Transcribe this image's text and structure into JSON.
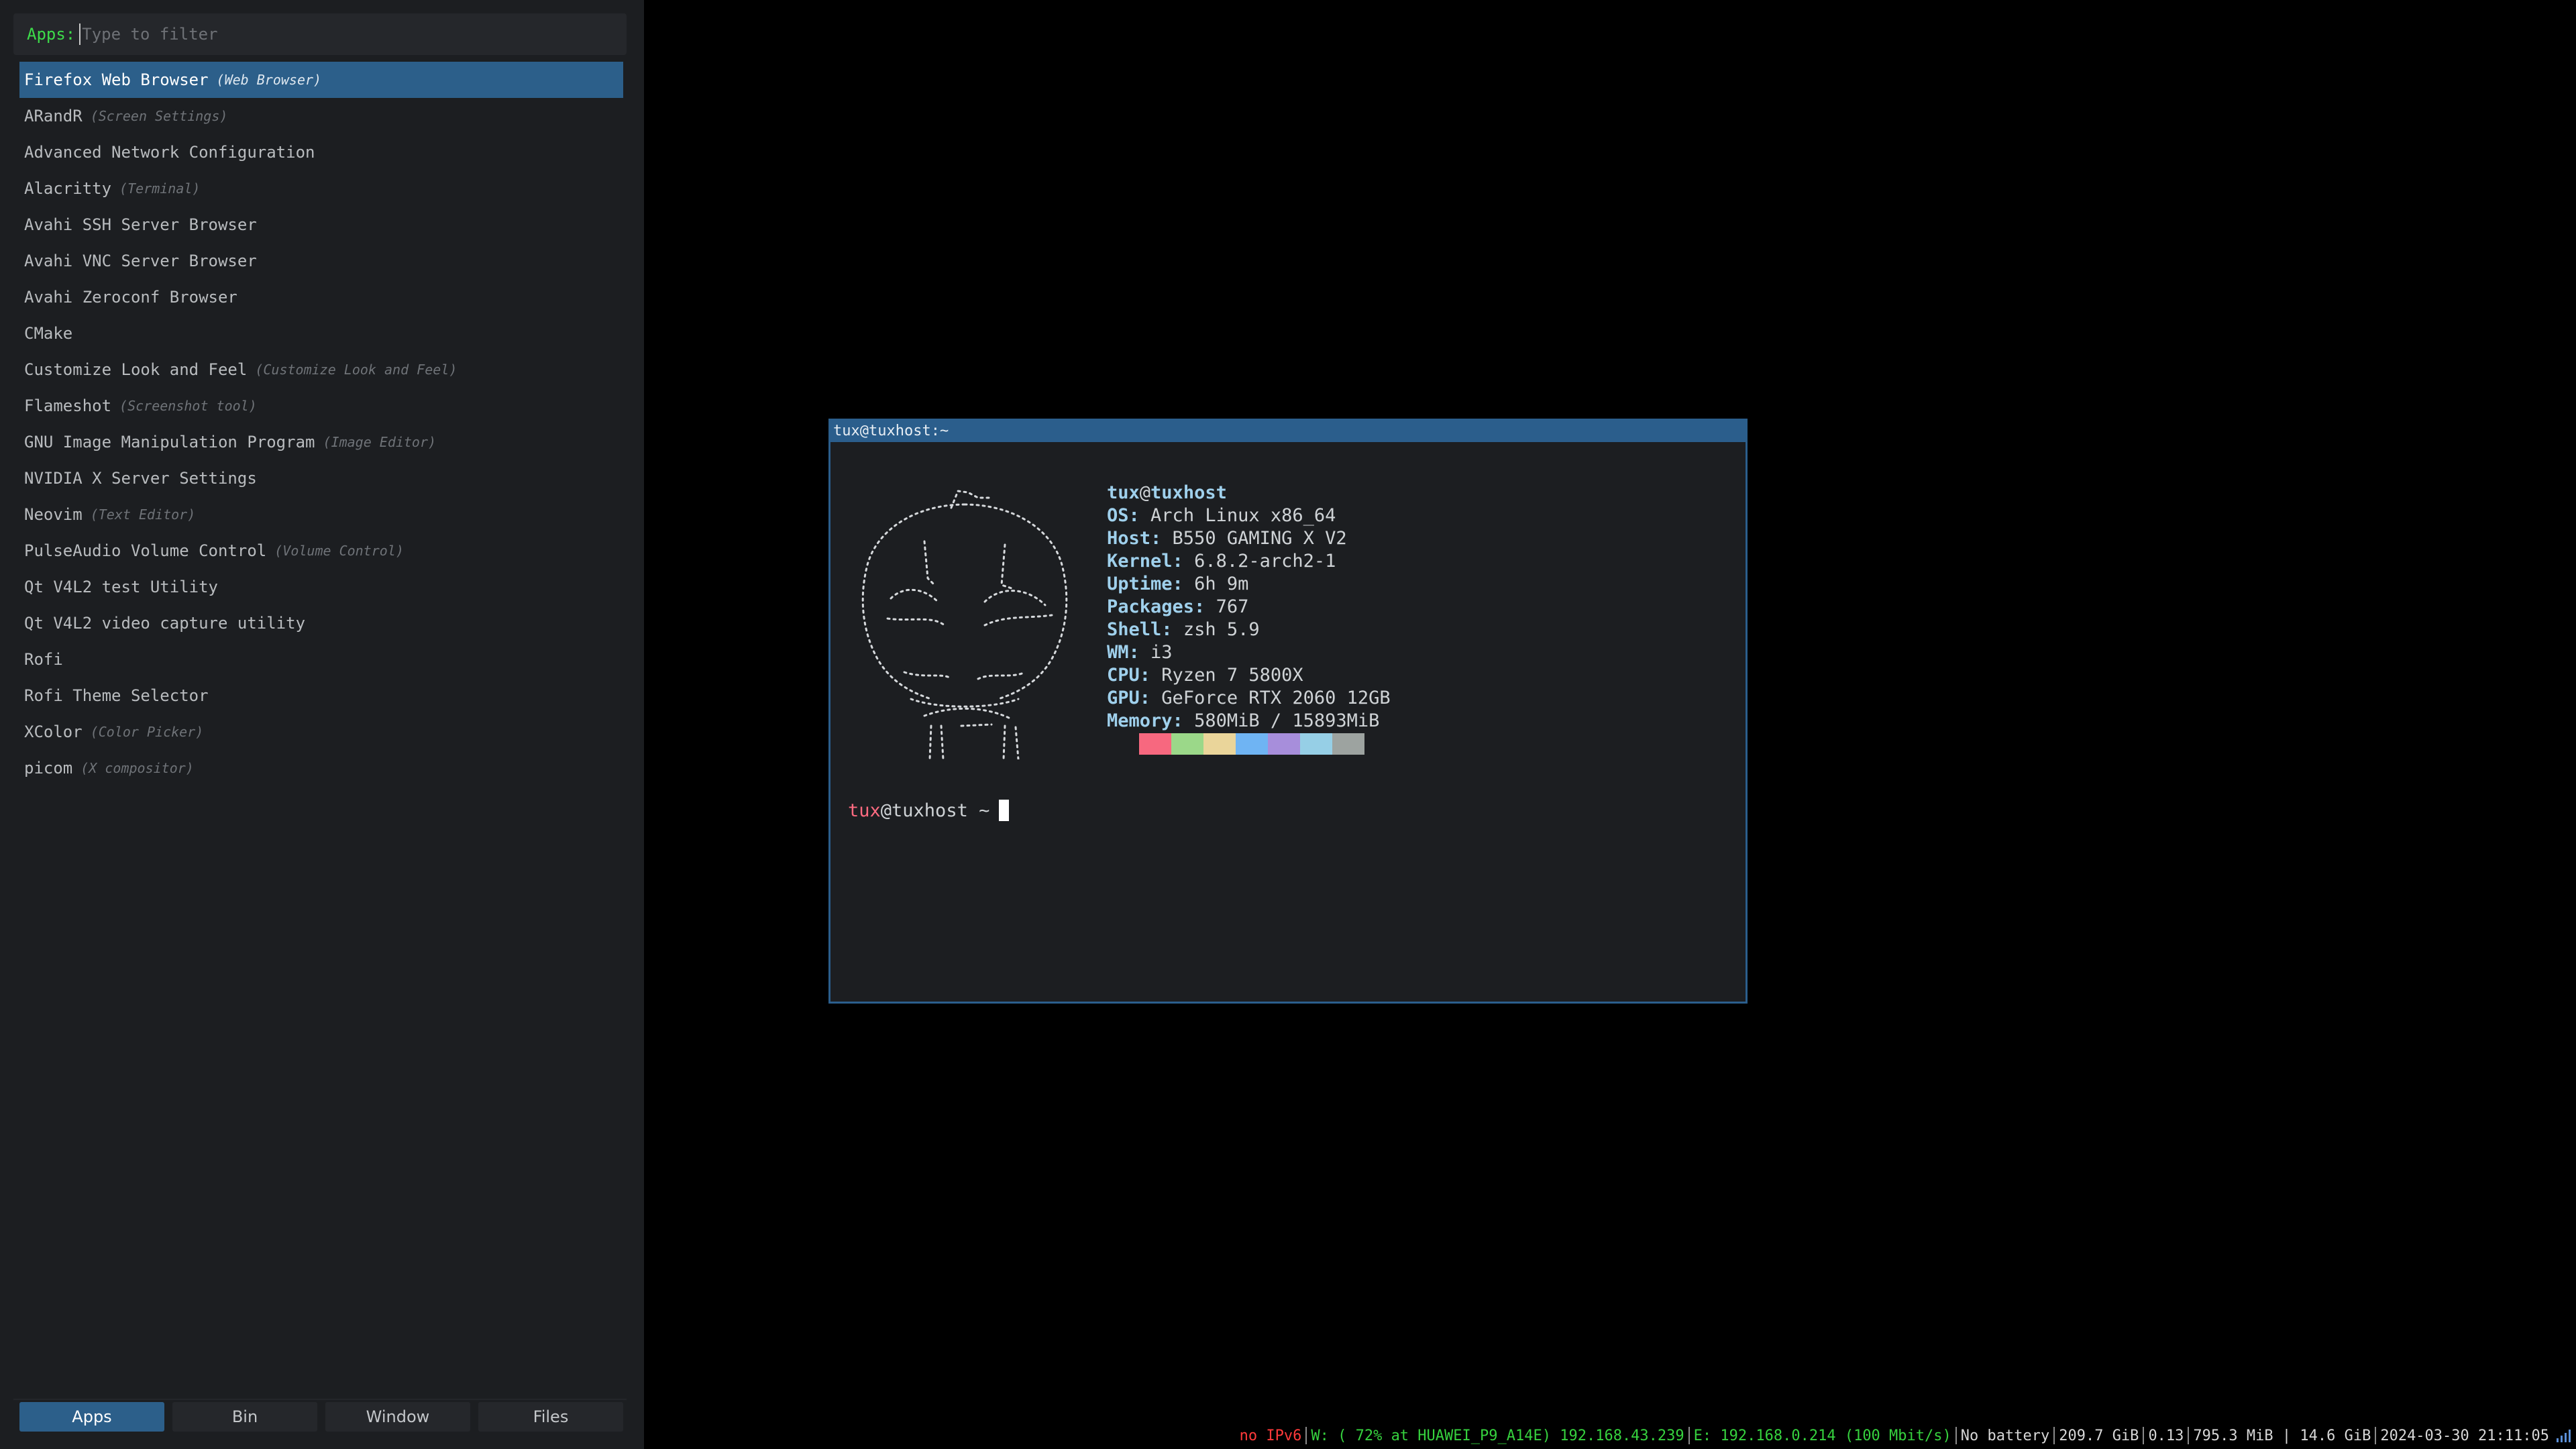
{
  "rofi": {
    "prompt": "Apps:",
    "placeholder": "Type to filter",
    "items": [
      {
        "label": "Firefox Web Browser",
        "desc": "(Web Browser)"
      },
      {
        "label": "ARandR",
        "desc": "(Screen Settings)"
      },
      {
        "label": "Advanced Network Configuration",
        "desc": ""
      },
      {
        "label": "Alacritty",
        "desc": "(Terminal)"
      },
      {
        "label": "Avahi SSH Server Browser",
        "desc": ""
      },
      {
        "label": "Avahi VNC Server Browser",
        "desc": ""
      },
      {
        "label": "Avahi Zeroconf Browser",
        "desc": ""
      },
      {
        "label": "CMake",
        "desc": ""
      },
      {
        "label": "Customize Look and Feel",
        "desc": "(Customize Look and Feel)"
      },
      {
        "label": "Flameshot",
        "desc": "(Screenshot tool)"
      },
      {
        "label": "GNU Image Manipulation Program",
        "desc": "(Image Editor)"
      },
      {
        "label": "NVIDIA X Server Settings",
        "desc": ""
      },
      {
        "label": "Neovim",
        "desc": "(Text Editor)"
      },
      {
        "label": "PulseAudio Volume Control",
        "desc": "(Volume Control)"
      },
      {
        "label": "Qt V4L2 test Utility",
        "desc": ""
      },
      {
        "label": "Qt V4L2 video capture utility",
        "desc": ""
      },
      {
        "label": "Rofi",
        "desc": ""
      },
      {
        "label": "Rofi Theme Selector",
        "desc": ""
      },
      {
        "label": "XColor",
        "desc": "(Color Picker)"
      },
      {
        "label": "picom",
        "desc": "(X compositor)"
      }
    ],
    "modes": [
      "Apps",
      "Bin",
      "Window",
      "Files"
    ],
    "active_mode": "Apps"
  },
  "terminal": {
    "title": "tux@tuxhost:~",
    "header": {
      "user": "tux",
      "at": "@",
      "host": "tuxhost"
    },
    "info": [
      {
        "key": "OS:",
        "value": "Arch Linux x86_64"
      },
      {
        "key": "Host:",
        "value": "B550 GAMING X V2"
      },
      {
        "key": "Kernel:",
        "value": "6.8.2-arch2-1"
      },
      {
        "key": "Uptime:",
        "value": "6h 9m"
      },
      {
        "key": "Packages:",
        "value": "767"
      },
      {
        "key": "Shell:",
        "value": "zsh 5.9"
      },
      {
        "key": "WM:",
        "value": "i3"
      },
      {
        "key": "CPU:",
        "value": "Ryzen 7 5800X"
      },
      {
        "key": "GPU:",
        "value": "GeForce RTX 2060 12GB"
      },
      {
        "key": "Memory:",
        "value": "580MiB / 15893MiB"
      }
    ],
    "palette": [
      "#1c1e21",
      "#f7687f",
      "#9bd889",
      "#ead59a",
      "#6fb4f3",
      "#a78edb",
      "#96cfe6",
      "#9da3a0"
    ],
    "prompt": {
      "user": "tux",
      "rest": "@tuxhost ~"
    }
  },
  "statusbar": {
    "ipv6": "no IPv6",
    "wifi": "W: ( 72% at HUAWEI_P9_A14E) 192.168.43.239",
    "eth": "E: 192.168.0.214 (100 Mbit/s)",
    "battery": "No battery",
    "disk": "209.7 GiB",
    "load": "0.13",
    "memory": "795.3 MiB | 14.6 GiB",
    "datetime": "2024-03-30 21:11:05",
    "tray_icon": "signal-bars-icon"
  }
}
